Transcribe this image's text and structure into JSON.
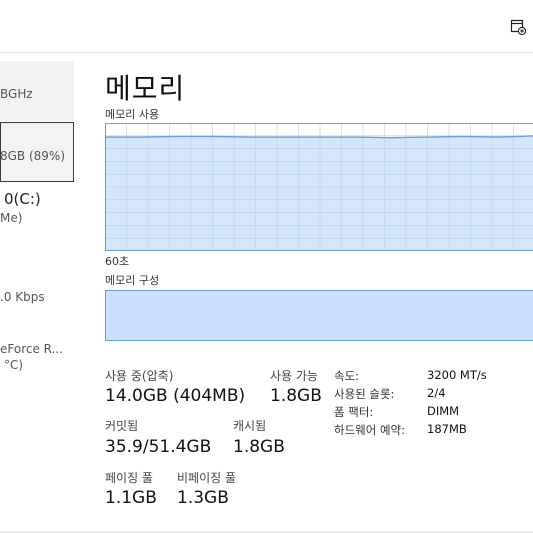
{
  "header": {
    "icon": "open-window-icon"
  },
  "sidebar": {
    "items": [
      {
        "line1": "BGHz"
      },
      {
        "line1": "8GB (89%)"
      },
      {
        "line1": "0(C:)",
        "line2": "Me)"
      },
      {
        "line1": ".0 Kbps"
      },
      {
        "line1": "eForce R...",
        "line2": "°C)"
      }
    ]
  },
  "main": {
    "title": "메모리",
    "usage_label": "메모리 사용",
    "time_label": "60초",
    "composition_label": "메모리 구성",
    "stats": {
      "in_use_label": "사용 중(압축)",
      "in_use_value": "14.0GB (404MB)",
      "available_label": "사용 가능",
      "available_value": "1.8GB",
      "committed_label": "커밋됨",
      "committed_value": "35.9/51.4GB",
      "cached_label": "캐시됨",
      "cached_value": "1.8GB",
      "paged_label": "페이징 풀",
      "paged_value": "1.1GB",
      "nonpaged_label": "비페이징 풀",
      "nonpaged_value": "1.3GB"
    },
    "props": {
      "speed_label": "속도:",
      "speed_value": "3200 MT/s",
      "slots_label": "사용된 슬롯:",
      "slots_value": "2/4",
      "form_label": "폼 팩터:",
      "form_value": "DIMM",
      "reserved_label": "하드웨어 예약:",
      "reserved_value": "187MB"
    }
  },
  "chart_data": {
    "type": "area",
    "x": [
      0,
      5,
      10,
      15,
      20,
      25,
      30,
      35,
      40,
      45,
      50,
      55,
      60
    ],
    "values": [
      89,
      89,
      89.5,
      89.5,
      89,
      89,
      89,
      89,
      88.5,
      89,
      89.5,
      89,
      90
    ],
    "xlabel": "60초",
    "ylim": [
      0,
      100
    ],
    "grid": true,
    "colors": {
      "line": "#6d9bd6",
      "fill": "#d4e6fb",
      "grid": "#b9cfe7",
      "border": "#6d9bd6"
    }
  }
}
